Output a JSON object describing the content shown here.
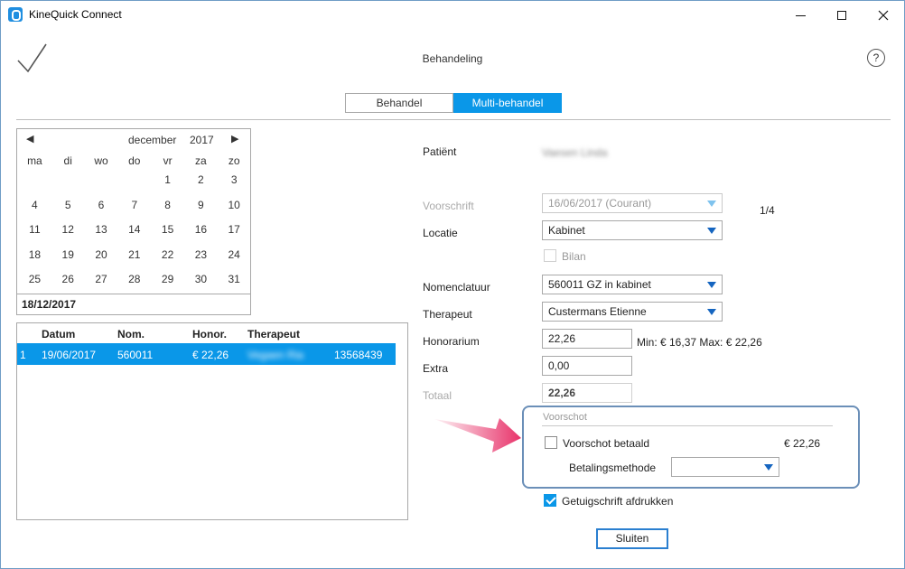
{
  "window": {
    "title": "KineQuick Connect"
  },
  "header": {
    "title": "Behandeling",
    "help": "?"
  },
  "tabs": [
    {
      "label": "Behandel",
      "active": false
    },
    {
      "label": "Multi-behandel",
      "active": true
    }
  ],
  "calendar": {
    "prev": "◀",
    "next": "▶",
    "month": "december",
    "year": "2017",
    "weekdays": [
      "ma",
      "di",
      "wo",
      "do",
      "vr",
      "za",
      "zo"
    ],
    "weeks": [
      [
        "",
        "",
        "",
        "",
        "1",
        "2",
        "3"
      ],
      [
        "4",
        "5",
        "6",
        "7",
        "8",
        "9",
        "10"
      ],
      [
        "11",
        "12",
        "13",
        "14",
        "15",
        "16",
        "17"
      ],
      [
        "18",
        "19",
        "20",
        "21",
        "22",
        "23",
        "24"
      ],
      [
        "25",
        "26",
        "27",
        "28",
        "29",
        "30",
        "31"
      ]
    ],
    "selected_date": "18/12/2017"
  },
  "table": {
    "columns": [
      "Datum",
      "Nom.",
      "Honor.",
      "Therapeut"
    ],
    "rows": [
      {
        "index": "1",
        "datum": "19/06/2017",
        "nom": "560011",
        "honor": "€ 22,26",
        "therapeut": "Vegaen Ria",
        "number": "13568439",
        "selected": true
      }
    ]
  },
  "form": {
    "patient_label": "Patiënt",
    "patient_value": "Vaesen Linda",
    "voorschrift_label": "Voorschrift",
    "voorschrift_value": "16/06/2017 (Courant)",
    "voorschrift_count": "1/4",
    "locatie_label": "Locatie",
    "locatie_value": "Kabinet",
    "bilan_label": "Bilan",
    "nomenclatuur_label": "Nomenclatuur",
    "nomenclatuur_value": "560011 GZ in kabinet",
    "therapeut_label": "Therapeut",
    "therapeut_value": "Custermans Etienne",
    "honorarium_label": "Honorarium",
    "honorarium_value": "22,26",
    "honorarium_range": "Min: € 16,37 Max: € 22,26",
    "extra_label": "Extra",
    "extra_value": "0,00",
    "totaal_label": "Totaal",
    "totaal_value": "22,26"
  },
  "voorschot": {
    "section_title": "Voorschot",
    "betaald_label": "Voorschot betaald",
    "betaald_checked": false,
    "amount": "€ 22,26",
    "methode_label": "Betalingsmethode",
    "methode_value": ""
  },
  "getuigschrift": {
    "label": "Getuigschrift afdrukken",
    "checked": true
  },
  "close_button": "Sluiten",
  "colors": {
    "accent": "#0a97e8",
    "highlight_border": "#6b8fb8",
    "arrow": "#e8336a"
  }
}
